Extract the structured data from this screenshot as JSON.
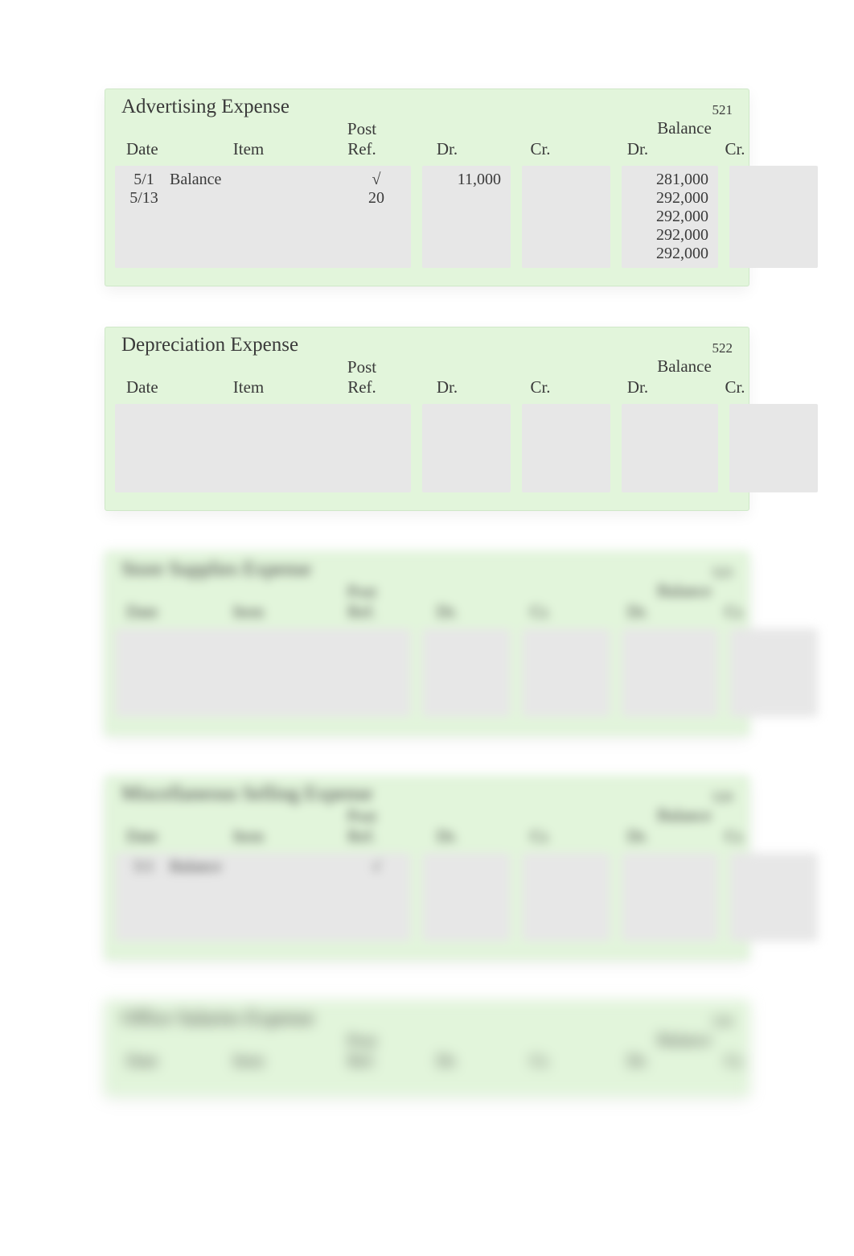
{
  "headers": {
    "date": "Date",
    "item": "Item",
    "post_ref_top": "Post",
    "post_ref_bot": "Ref.",
    "dr": "Dr.",
    "cr": "Cr.",
    "balance": "Balance",
    "bal_dr": "Dr.",
    "bal_cr": "Cr."
  },
  "ledgers": [
    {
      "id": "advertising-expense",
      "name": "Advertising Expense",
      "acct_no": "521",
      "blur": "",
      "rows": [
        {
          "date": "5/1",
          "item": "Balance",
          "post_ref": "√",
          "dr": "",
          "cr": "",
          "bal_dr": "281,000",
          "bal_cr": ""
        },
        {
          "date": "5/13",
          "item": "",
          "post_ref": "20",
          "dr": "11,000",
          "cr": "",
          "bal_dr": "292,000",
          "bal_cr": ""
        },
        {
          "date": "",
          "item": "",
          "post_ref": "",
          "dr": "",
          "cr": "",
          "bal_dr": "292,000",
          "bal_cr": ""
        },
        {
          "date": "",
          "item": "",
          "post_ref": "",
          "dr": "",
          "cr": "",
          "bal_dr": "292,000",
          "bal_cr": ""
        },
        {
          "date": "",
          "item": "",
          "post_ref": "",
          "dr": "",
          "cr": "",
          "bal_dr": "292,000",
          "bal_cr": ""
        }
      ]
    },
    {
      "id": "depreciation-expense",
      "name": "Depreciation Expense",
      "acct_no": "522",
      "blur": "",
      "rows": [
        {
          "date": "",
          "item": "",
          "post_ref": "",
          "dr": "",
          "cr": "",
          "bal_dr": "",
          "bal_cr": ""
        },
        {
          "date": "",
          "item": "",
          "post_ref": "",
          "dr": "",
          "cr": "",
          "bal_dr": "",
          "bal_cr": ""
        },
        {
          "date": "",
          "item": "",
          "post_ref": "",
          "dr": "",
          "cr": "",
          "bal_dr": "",
          "bal_cr": ""
        },
        {
          "date": "",
          "item": "",
          "post_ref": "",
          "dr": "",
          "cr": "",
          "bal_dr": "",
          "bal_cr": ""
        }
      ]
    },
    {
      "id": "store-supplies-expense",
      "name": "Store Supplies Expense",
      "acct_no": "523",
      "blur": "blur-1",
      "rows": [
        {
          "date": "",
          "item": "",
          "post_ref": "",
          "dr": "",
          "cr": "",
          "bal_dr": "",
          "bal_cr": ""
        },
        {
          "date": "",
          "item": "",
          "post_ref": "",
          "dr": "",
          "cr": "",
          "bal_dr": "",
          "bal_cr": ""
        },
        {
          "date": "",
          "item": "",
          "post_ref": "",
          "dr": "",
          "cr": "",
          "bal_dr": "",
          "bal_cr": ""
        }
      ]
    },
    {
      "id": "misc-selling-expense",
      "name": "Miscellaneous Selling Expense",
      "acct_no": "529",
      "blur": "blur-1",
      "rows": [
        {
          "date": "5/1",
          "item": "Balance",
          "post_ref": "√",
          "dr": "",
          "cr": "",
          "bal_dr": "",
          "bal_cr": ""
        },
        {
          "date": "",
          "item": "",
          "post_ref": "",
          "dr": "",
          "cr": "",
          "bal_dr": "",
          "bal_cr": ""
        },
        {
          "date": "",
          "item": "",
          "post_ref": "",
          "dr": "",
          "cr": "",
          "bal_dr": "",
          "bal_cr": ""
        },
        {
          "date": "",
          "item": "",
          "post_ref": "",
          "dr": "",
          "cr": "",
          "bal_dr": "",
          "bal_cr": ""
        }
      ]
    },
    {
      "id": "office-salaries-expense",
      "name": "Office Salaries Expense",
      "acct_no": "530",
      "blur": "blur-2",
      "rows": []
    }
  ]
}
